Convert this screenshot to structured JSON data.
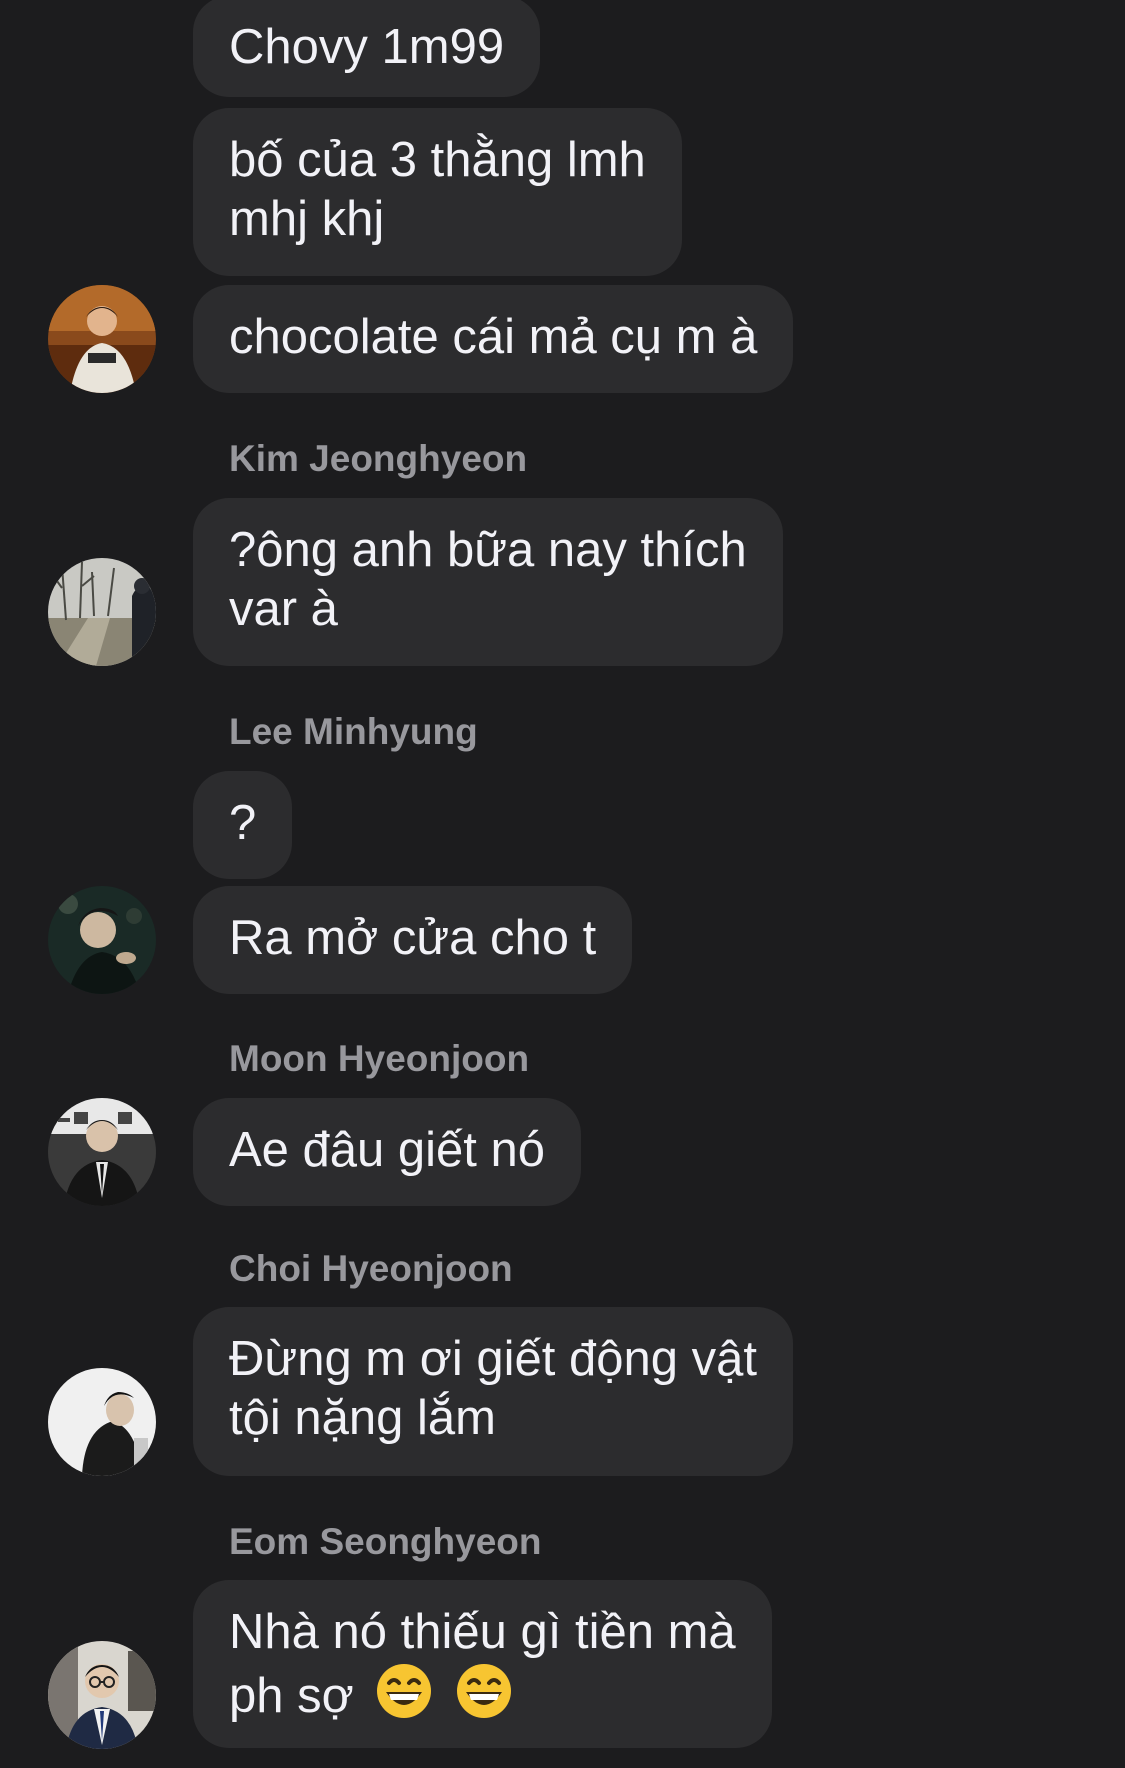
{
  "messages": [
    {
      "sender": "",
      "lines": [
        "Chovy 1m99"
      ]
    },
    {
      "sender": "",
      "lines": [
        "bố của 3 thằng lmh",
        "mhj khj"
      ]
    },
    {
      "sender": "",
      "lines": [
        "chocolate cái mả cụ m à"
      ],
      "avatar": "avatar-1"
    },
    {
      "sender": "Kim Jeonghyeon",
      "lines": [
        "?ông anh bữa nay thích",
        "var à"
      ],
      "avatar": "avatar-kim-jeonghyeon"
    },
    {
      "sender": "Lee Minhyung",
      "lines": [
        "?"
      ]
    },
    {
      "sender": "",
      "lines": [
        "Ra mở cửa cho t"
      ],
      "avatar": "avatar-lee-minhyung"
    },
    {
      "sender": "Moon Hyeonjoon",
      "lines": [
        "Ae đâu giết nó"
      ],
      "avatar": "avatar-moon-hyeonjoon"
    },
    {
      "sender": "Choi Hyeonjoon",
      "lines": [
        "Đừng m ơi giết động vật",
        "tội nặng lắm"
      ],
      "avatar": "avatar-choi-hyeonjoon"
    },
    {
      "sender": "Eom Seonghyeon",
      "lines": [
        "Nhà nó thiếu gì tiền mà",
        "ph sợ"
      ],
      "emojis": [
        "grinning-face-icon",
        "grinning-face-icon"
      ],
      "avatar": "avatar-eom-seonghyeon"
    }
  ],
  "colors": {
    "background": "#1c1c1e",
    "bubble": "#2c2c2e",
    "message_text": "#f2f2f7",
    "sender_text": "#98989d"
  }
}
